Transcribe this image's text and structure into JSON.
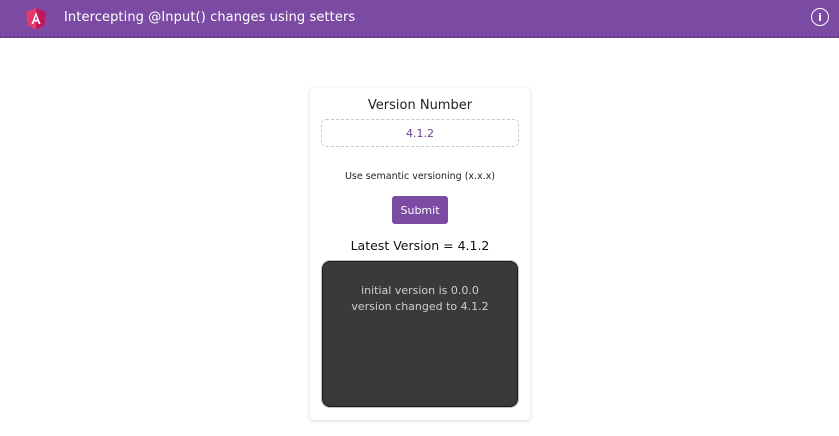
{
  "header": {
    "title": "Intercepting @Input() changes using setters",
    "info_icon": "info-circle-icon",
    "logo_icon": "angular-logo-icon",
    "background_color": "#7b4ba3"
  },
  "form": {
    "label": "Version Number",
    "input_value": "4.1.2",
    "hint": "Use semantic versioning (x.x.x)",
    "submit_label": "Submit"
  },
  "result": {
    "latest_label": "Latest Version = 4.1.2"
  },
  "log": {
    "lines": [
      "initial version is 0.0.0",
      "version changed to 4.1.2"
    ]
  }
}
